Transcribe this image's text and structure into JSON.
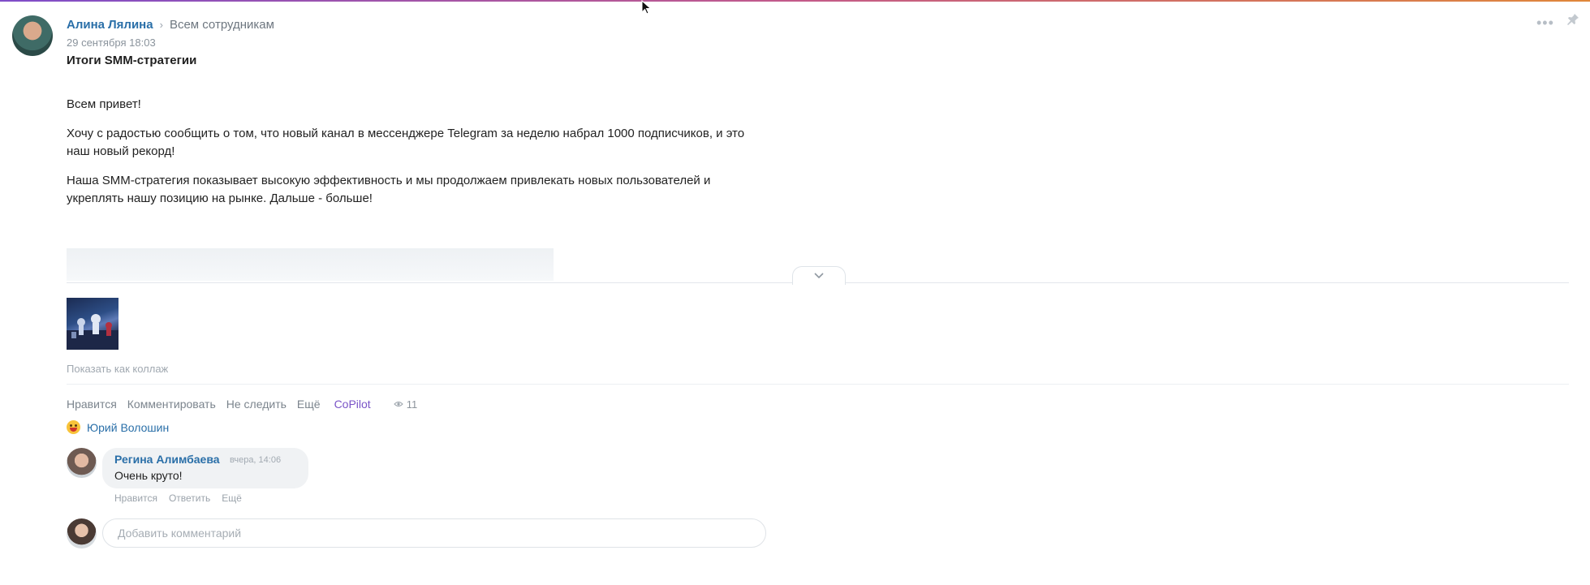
{
  "post": {
    "author": "Алина Лялина",
    "recipients": "Всем сотрудникам",
    "date": "29 сентября 18:03",
    "title": "Итоги SMM-стратегии",
    "paragraphs": [
      "Всем привет!",
      "Хочу с радостью сообщить о том, что новый канал в мессенджере Telegram за неделю набрал 1000 подписчиков, и это наш новый рекорд!",
      "Наша SMM-стратегия показывает высокую эффективность и мы продолжаем привлекать новых пользователей и укреплять нашу позицию на рынке. Дальше - больше!"
    ],
    "collage_link": "Показать как коллаж"
  },
  "actions": {
    "like": "Нравится",
    "comment": "Комментировать",
    "unfollow": "Не следить",
    "more": "Ещё",
    "copilot": "CoPilot",
    "views": "11"
  },
  "likes": {
    "user": "Юрий Волошин"
  },
  "comment": {
    "author": "Регина Алимбаева",
    "time": "вчера, 14:06",
    "text": "Очень круто!",
    "like": "Нравится",
    "reply": "Ответить",
    "more": "Ещё"
  },
  "new_comment": {
    "placeholder": "Добавить комментарий"
  },
  "colors": {
    "link": "#2a6fa8",
    "copilot": "#7a54c7"
  }
}
